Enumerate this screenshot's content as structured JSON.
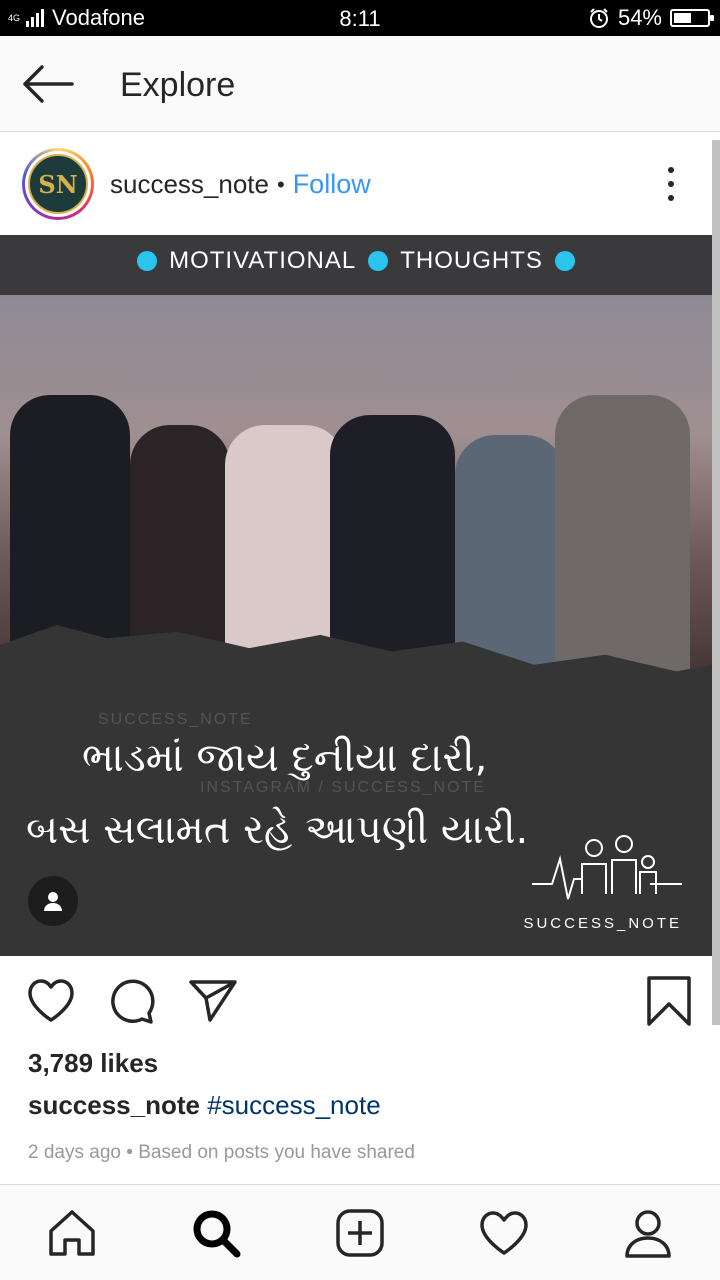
{
  "status_bar": {
    "network_top": "4G",
    "carrier": "Vodafone",
    "time": "8:11",
    "battery": "54%",
    "battery_level": 0.54
  },
  "header": {
    "title": "Explore",
    "back_icon": "arrow-left-icon"
  },
  "post": {
    "username": "success_note",
    "separator": "•",
    "follow_label": "Follow",
    "avatar_text": "SN",
    "image": {
      "tags": [
        "MOTIVATIONAL",
        "THOUGHTS"
      ],
      "quote_line1": "ભાડમાં જાય દુનીયા દારી,",
      "quote_line2": "બસ સલામત રહે આપણી યારી.",
      "watermark1": "SUCCESS_NOTE",
      "watermark2": "INSTAGRAM / SUCCESS_NOTE",
      "brand": "SUCCESS_NOTE"
    },
    "likes": "3,789 likes",
    "caption_user": "success_note",
    "caption_hashtag": "#success_note",
    "time_ago": "2 days ago",
    "meta_dot": "•",
    "context": "Based on posts you have shared"
  },
  "bottom_nav": [
    "home-icon",
    "search-icon",
    "new-post-icon",
    "activity-heart-icon",
    "profile-icon"
  ]
}
